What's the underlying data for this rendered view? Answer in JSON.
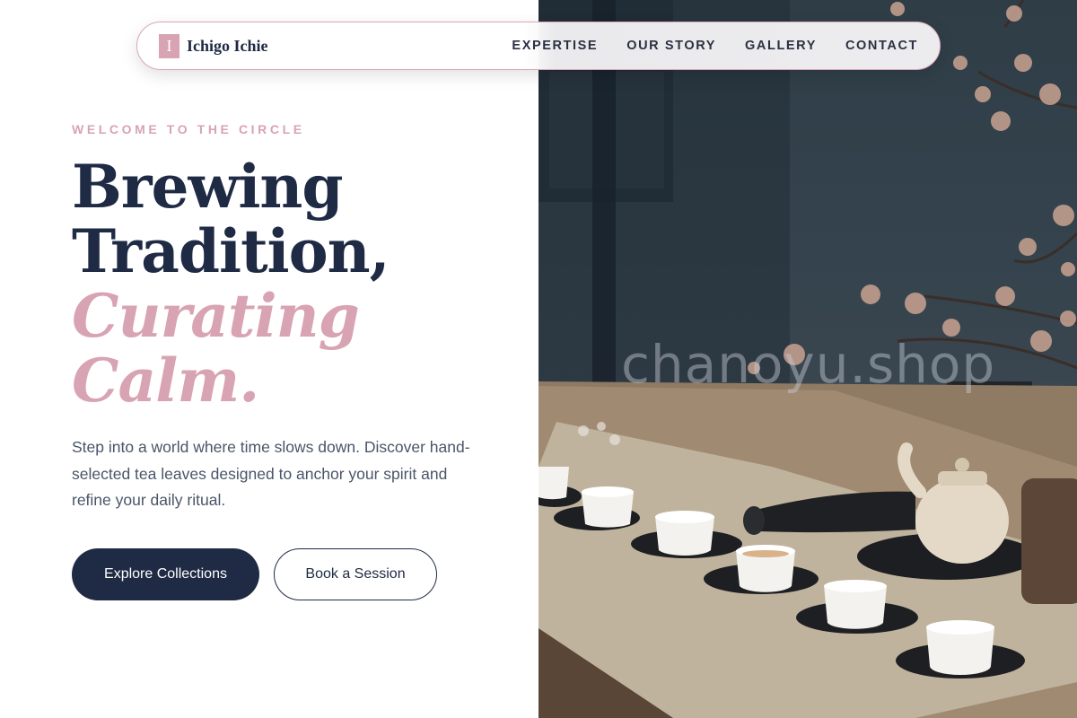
{
  "nav": {
    "logo_mark": "I",
    "brand": "Ichigo Ichie",
    "links": [
      "EXPERTISE",
      "OUR STORY",
      "GALLERY",
      "CONTACT"
    ]
  },
  "hero": {
    "eyebrow": "WELCOME TO THE CIRCLE",
    "headline_line1": "Brewing",
    "headline_line2": "Tradition,",
    "headline_accent1": "Curating",
    "headline_accent2": "Calm.",
    "description": "Step into a world where time slows down. Discover hand-selected tea leaves designed to anchor your spirit and refine your daily ritual.",
    "primary_button": "Explore Collections",
    "secondary_button": "Book a Session"
  },
  "image": {
    "watermark": "chanoyu.shop"
  },
  "colors": {
    "accent": "#d8a3b3",
    "navy": "#1f2a44",
    "body_text": "#4a5568"
  }
}
